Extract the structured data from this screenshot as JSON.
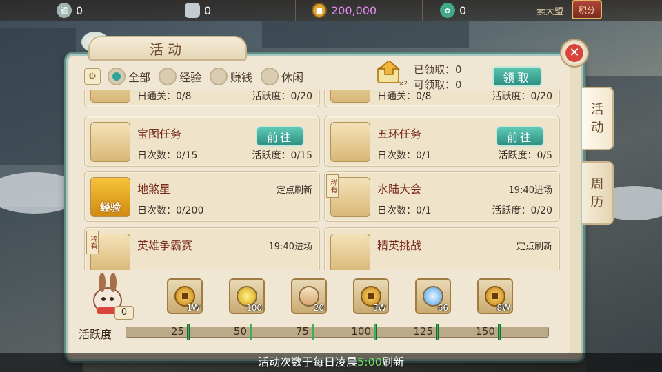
{
  "topbar": {
    "currencies": [
      {
        "icon": "silver-coin-icon",
        "value": "0"
      },
      {
        "icon": "silver-ingot-icon",
        "value": "0"
      },
      {
        "icon": "gold-coin-icon",
        "value": "200,000"
      },
      {
        "icon": "jade-icon",
        "value": "0"
      }
    ],
    "extra_text": "索大盟",
    "score_badge": "积分"
  },
  "panel": {
    "title": "活动",
    "close_icon": "close-icon"
  },
  "filters": {
    "options": [
      {
        "label": "全部",
        "selected": true
      },
      {
        "label": "经验",
        "selected": false
      },
      {
        "label": "赚钱",
        "selected": false
      },
      {
        "label": "休闲",
        "selected": false
      }
    ]
  },
  "claim": {
    "received": "已领取：0",
    "available": "可领取：0",
    "button": "领取"
  },
  "side_tabs": [
    "活动",
    "周历"
  ],
  "cards": [
    {
      "name": "",
      "stat1": "日通关：0/8",
      "stat2": "活跃度：0/20",
      "col": 0,
      "row": 0,
      "partial": true
    },
    {
      "name": "",
      "stat1": "日通关：0/8",
      "stat2": "活跃度：0/20",
      "col": 1,
      "row": 0,
      "partial": true
    },
    {
      "name": "宝图任务",
      "stat1": "日次数：0/15",
      "stat2": "活跃度：0/15",
      "button": "前往",
      "col": 0,
      "row": 1
    },
    {
      "name": "五环任务",
      "stat1": "日次数：0/1",
      "stat2": "活跃度：0/5",
      "button": "前往",
      "col": 1,
      "row": 1
    },
    {
      "name": "地煞星",
      "stat1": "日次数：0/200",
      "time": "定点刷新",
      "thumb_text": "经验",
      "col": 0,
      "row": 2
    },
    {
      "name": "水陆大会",
      "stat1": "日次数：0/1",
      "stat2": "活跃度：0/20",
      "time": "19:40进场",
      "rare": "稀有",
      "col": 1,
      "row": 2
    },
    {
      "name": "英雄争霸赛",
      "time": "19:40进场",
      "rare": "稀有",
      "col": 0,
      "row": 3
    },
    {
      "name": "精英挑战",
      "time": "定点刷新",
      "col": 1,
      "row": 3
    }
  ],
  "rewards": {
    "mascot_value": "0",
    "items": [
      {
        "icon": "copper-coin-icon",
        "amount": "1W"
      },
      {
        "icon": "gold-flower-icon",
        "amount": "100"
      },
      {
        "icon": "scroll-icon",
        "amount": "20"
      },
      {
        "icon": "copper-coin-icon",
        "amount": "5W"
      },
      {
        "icon": "crystal-orb-icon",
        "amount": "66"
      },
      {
        "icon": "copper-coin-icon",
        "amount": "8W"
      }
    ]
  },
  "activity": {
    "label": "活跃度",
    "progress": 0,
    "ticks": [
      "25",
      "50",
      "75",
      "100",
      "125",
      "150"
    ]
  },
  "footer": {
    "before": "活动次数于每日凌晨",
    "highlight": "5:00",
    "after": "刷新"
  }
}
